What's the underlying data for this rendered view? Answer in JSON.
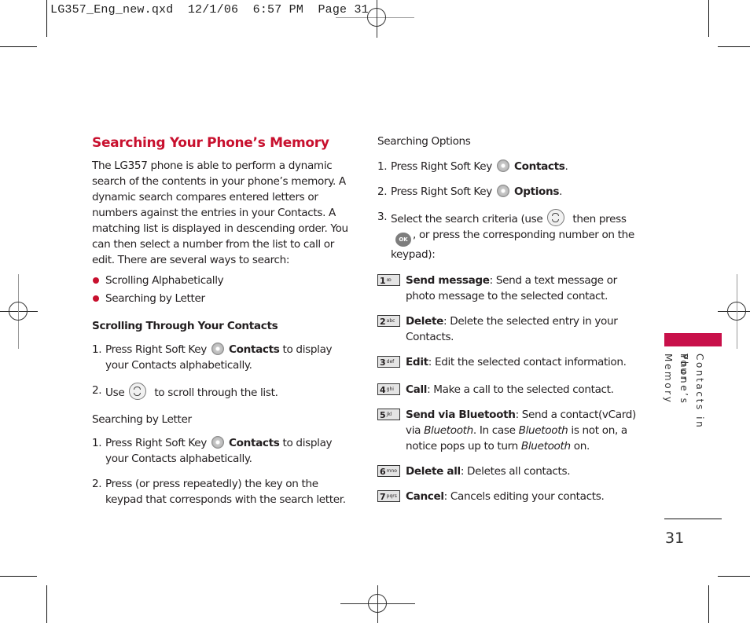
{
  "slug": {
    "text": "LG357_Eng_new.qxd  12/1/06  6:57 PM  Page 31"
  },
  "left": {
    "title": "Searching Your Phone’s Memory",
    "intro": "The LG357 phone is able to perform a dynamic search of the contents in your phone’s memory. A dynamic search compares entered letters or numbers against the entries in your Contacts. A matching list is displayed in descending order. You can then select a number from the list to call or edit. There are several ways to search:",
    "bullets": [
      "Scrolling Alphabetically",
      "Searching by Letter"
    ],
    "scrolling": {
      "heading": "Scrolling Through Your Contacts",
      "steps": [
        {
          "num": "1.",
          "pre": "Press Right Soft Key",
          "bold": "Contacts",
          "post": " to display your Contacts alphabetically."
        },
        {
          "num": "2.",
          "pre": "Use",
          "post": " to scroll through the list."
        }
      ]
    },
    "by_letter": {
      "heading": "Searching by Letter",
      "steps": [
        {
          "num": "1.",
          "pre": "Press Right Soft Key",
          "bold": "Contacts",
          "post": " to display your Contacts alphabetically."
        },
        {
          "num": "2.",
          "text": "Press (or press repeatedly) the key on the keypad that corresponds with the search letter."
        }
      ]
    }
  },
  "right": {
    "heading": "Searching Options",
    "steps": [
      {
        "num": "1.",
        "pre": "Press Right Soft Key",
        "bold": "Contacts",
        "post": "."
      },
      {
        "num": "2.",
        "pre": "Press Right Soft Key",
        "bold": "Options",
        "post": "."
      },
      {
        "num": "3.",
        "pre": "Select the search criteria (use",
        "mid": " then press",
        "post": ", or press the corresponding number on the keypad):",
        "ok_label": "OK"
      }
    ],
    "options": [
      {
        "key": "1",
        "key_sub": "ꝏ",
        "bold": "Send message",
        "text": ": Send a text message or photo message to the selected contact."
      },
      {
        "key": "2",
        "key_sub": "abc",
        "bold": "Delete",
        "text": ": Delete the selected entry in your Contacts."
      },
      {
        "key": "3",
        "key_sub": "def",
        "bold": "Edit",
        "text": ": Edit the selected contact information."
      },
      {
        "key": "4",
        "key_sub": "ghi",
        "bold": "Call",
        "text": ": Make a call to the selected contact."
      },
      {
        "key": "5",
        "key_sub": "jkl",
        "bold": "Send via Bluetooth",
        "text_a": ": Send a contact(vCard) via ",
        "ital_a": "Bluetooth",
        "text_b": ". In case ",
        "ital_b": "Bluetooth",
        "text_c": " is not on, a notice pops up to turn ",
        "ital_c": "Bluetooth",
        "text_d": " on."
      },
      {
        "key": "6",
        "key_sub": "mno",
        "bold": "Delete all",
        "text": ": Deletes all contacts."
      },
      {
        "key": "7",
        "key_sub": "pqrs",
        "bold": "Cancel",
        "text": ": Cancels editing your contacts."
      }
    ]
  },
  "sidebar": {
    "line1": "Contacts in Your",
    "line2": "Phone’s Memory",
    "accent_color": "#c8104a"
  },
  "page_number": "31"
}
